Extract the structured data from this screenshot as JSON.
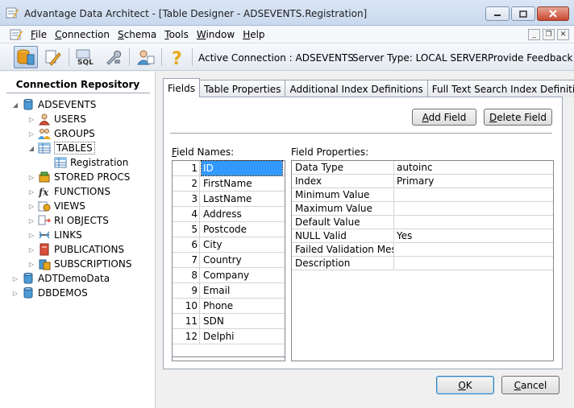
{
  "window": {
    "title": "Advantage Data Architect - [Table Designer - ADSEVENTS.Registration]"
  },
  "menu": {
    "items": [
      {
        "label": "File",
        "accel": "F"
      },
      {
        "label": "Connection",
        "accel": "C"
      },
      {
        "label": "Schema",
        "accel": "S"
      },
      {
        "label": "Tools",
        "accel": "T"
      },
      {
        "label": "Window",
        "accel": "W"
      },
      {
        "label": "Help",
        "accel": "H"
      }
    ]
  },
  "toolbar": {
    "active_connection": "Active Connection : ADSEVENTS",
    "server_type": "Server Type: LOCAL SERVER",
    "feedback": "Provide Feedback"
  },
  "sidebar": {
    "title": "Connection Repository",
    "tree": [
      {
        "label": "ADSEVENTS",
        "icon": "database-icon",
        "level": 0,
        "expander": "expanded"
      },
      {
        "label": "USERS",
        "icon": "user-icon",
        "level": 1,
        "expander": "collapsed"
      },
      {
        "label": "GROUPS",
        "icon": "group-icon",
        "level": 1,
        "expander": "collapsed"
      },
      {
        "label": "TABLES",
        "icon": "table-icon",
        "level": 1,
        "expander": "expanded",
        "selected": true
      },
      {
        "label": "Registration",
        "icon": "table-icon",
        "level": 2,
        "expander": "none"
      },
      {
        "label": "STORED PROCS",
        "icon": "stored-proc-icon",
        "level": 1,
        "expander": "collapsed"
      },
      {
        "label": "FUNCTIONS",
        "icon": "function-icon",
        "level": 1,
        "expander": "collapsed"
      },
      {
        "label": "VIEWS",
        "icon": "view-icon",
        "level": 1,
        "expander": "collapsed"
      },
      {
        "label": "RI OBJECTS",
        "icon": "ri-objects-icon",
        "level": 1,
        "expander": "collapsed"
      },
      {
        "label": "LINKS",
        "icon": "link-icon",
        "level": 1,
        "expander": "collapsed"
      },
      {
        "label": "PUBLICATIONS",
        "icon": "publication-icon",
        "level": 1,
        "expander": "collapsed"
      },
      {
        "label": "SUBSCRIPTIONS",
        "icon": "subscription-icon",
        "level": 1,
        "expander": "collapsed"
      },
      {
        "label": "ADTDemoData",
        "icon": "database-icon",
        "level": 0,
        "expander": "collapsed"
      },
      {
        "label": "DBDEMOS",
        "icon": "database-icon",
        "level": 0,
        "expander": "collapsed"
      }
    ]
  },
  "tabs": [
    {
      "label": "Fields",
      "active": true
    },
    {
      "label": "Table Properties",
      "active": false
    },
    {
      "label": "Additional Index Definitions",
      "active": false
    },
    {
      "label": "Full Text Search Index Definitions",
      "active": false
    }
  ],
  "buttons": {
    "add_field": {
      "label": "Add Field",
      "accel": "A"
    },
    "delete_field": {
      "label": "Delete Field",
      "accel": "D"
    },
    "ok": {
      "label": "OK",
      "accel": "O"
    },
    "cancel": {
      "label": "Cancel",
      "accel": "C"
    }
  },
  "field_names": {
    "label": "Field Names:",
    "accel": "F",
    "rows": [
      {
        "num": "1",
        "name": "ID",
        "selected": true
      },
      {
        "num": "2",
        "name": "FirstName"
      },
      {
        "num": "3",
        "name": "LastName"
      },
      {
        "num": "4",
        "name": "Address"
      },
      {
        "num": "5",
        "name": "Postcode"
      },
      {
        "num": "6",
        "name": "City"
      },
      {
        "num": "7",
        "name": "Country"
      },
      {
        "num": "8",
        "name": "Company"
      },
      {
        "num": "9",
        "name": "Email"
      },
      {
        "num": "10",
        "name": "Phone"
      },
      {
        "num": "11",
        "name": "SDN"
      },
      {
        "num": "12",
        "name": "Delphi"
      }
    ]
  },
  "field_properties": {
    "label": "Field Properties:",
    "rows": [
      {
        "name": "Data Type",
        "value": "autoinc"
      },
      {
        "name": "Index",
        "value": "Primary"
      },
      {
        "name": "Minimum Value",
        "value": ""
      },
      {
        "name": "Maximum Value",
        "value": ""
      },
      {
        "name": "Default Value",
        "value": ""
      },
      {
        "name": "NULL Valid",
        "value": "Yes"
      },
      {
        "name": "Failed Validation Messa",
        "value": ""
      },
      {
        "name": "Description",
        "value": ""
      }
    ]
  },
  "colors": {
    "selection": "#3399ff",
    "titlebar": "#c9d9ee",
    "close_button": "#c9472f"
  }
}
